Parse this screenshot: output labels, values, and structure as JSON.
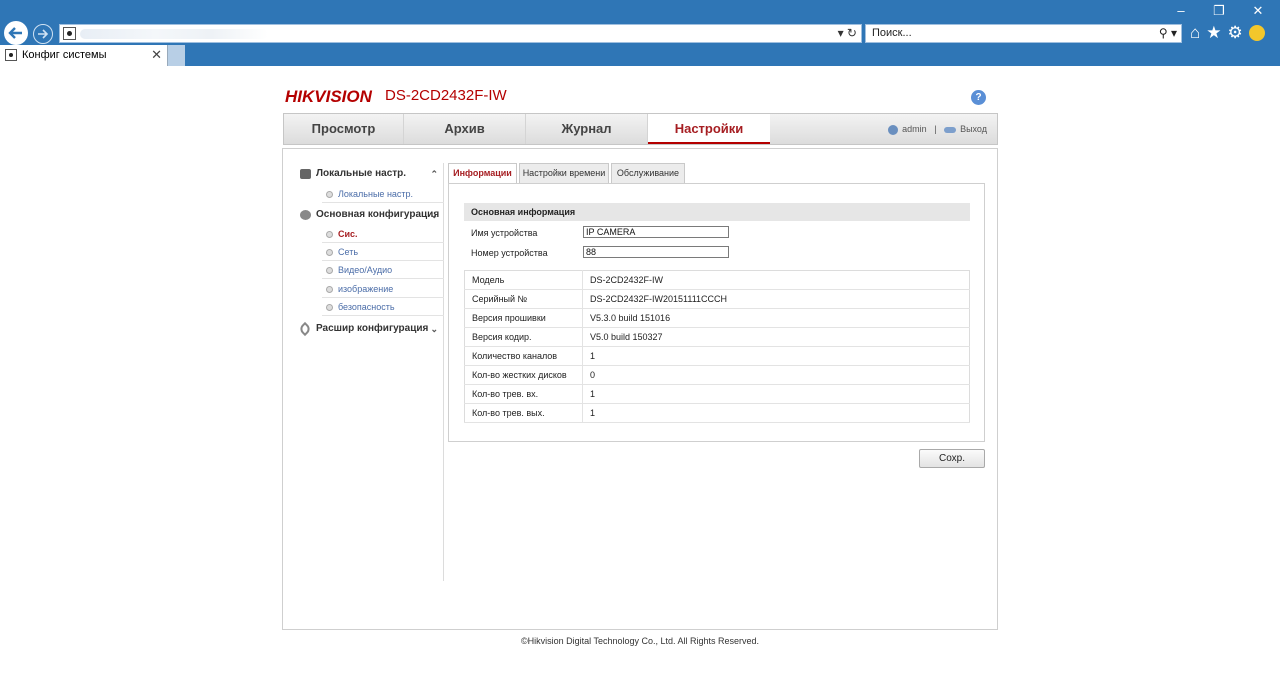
{
  "browser": {
    "window_controls": [
      "–",
      "❐",
      "✕"
    ],
    "address_tools": "▾ ↻",
    "search_placeholder": "Поиск...",
    "search_tools": "⚲ ▾",
    "tab_title": "Конфиг системы",
    "tab_close": "✕",
    "toolbar_icons": [
      "home-icon",
      "star-icon",
      "gear-icon",
      "smiley-icon"
    ]
  },
  "header": {
    "brand": "HIKVISION",
    "model": "DS-2CD2432F-IW",
    "help": "?"
  },
  "nav": {
    "items": [
      {
        "label": "Просмотр"
      },
      {
        "label": "Архив"
      },
      {
        "label": "Журнал"
      },
      {
        "label": "Настройки"
      }
    ],
    "active": "Настройки",
    "user": "admin",
    "divider": "|",
    "logout": "Выход"
  },
  "sidebar": {
    "local": {
      "label": "Локальные настр.",
      "chevron": "⌃",
      "items": [
        "Локальные настр."
      ]
    },
    "basic": {
      "label": "Основная конфигурация",
      "chevron": "⌄",
      "items": [
        "Сис.",
        "Сеть",
        "Видео/Аудио",
        "изображение",
        "безопасность"
      ]
    },
    "advanced": {
      "label": "Расшир конфигурация",
      "chevron": "⌄"
    }
  },
  "tabs": [
    "Информации",
    "Настройки времени",
    "Обслуживание"
  ],
  "section_title": "Основная информация",
  "fields": {
    "device_name_label": "Имя устройства",
    "device_name_value": "IP CAMERA",
    "device_number_label": "Номер устройства",
    "device_number_value": "88"
  },
  "info_rows": [
    {
      "key": "Модель",
      "value": "DS-2CD2432F-IW"
    },
    {
      "key": "Серийный №",
      "value": "DS-2CD2432F-IW20151111CCCH"
    },
    {
      "key": "Версия прошивки",
      "value": "V5.3.0 build 151016"
    },
    {
      "key": "Версия кодир.",
      "value": "V5.0 build 150327"
    },
    {
      "key": "Количество каналов",
      "value": "1"
    },
    {
      "key": "Кол-во жестких дисков",
      "value": "0"
    },
    {
      "key": "Кол-во трев. вх.",
      "value": "1"
    },
    {
      "key": "Кол-во трев. вых.",
      "value": "1"
    }
  ],
  "save_label": "Сохр.",
  "footer": "©Hikvision Digital Technology Co., Ltd. All Rights Reserved.",
  "colors": {
    "chrome": "#2f76b6",
    "brand_red": "#b40000",
    "link_blue": "#4b6da8"
  }
}
